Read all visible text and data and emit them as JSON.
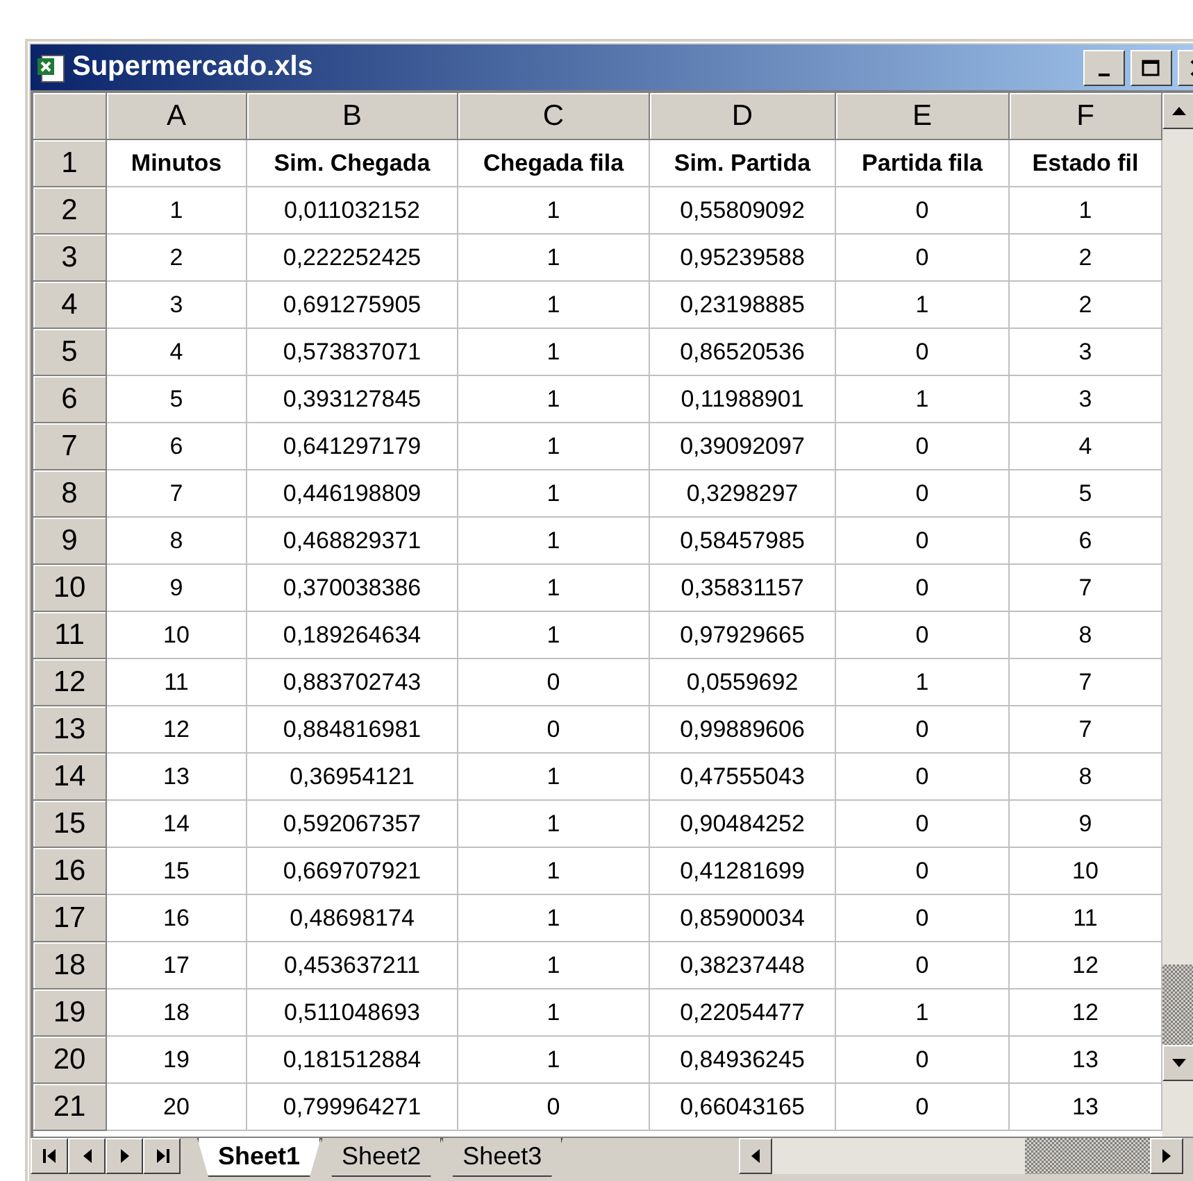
{
  "window": {
    "title": "Supermercado.xls"
  },
  "columns": [
    "A",
    "B",
    "C",
    "D",
    "E",
    "F"
  ],
  "label_row": {
    "number": "1",
    "cells": [
      "Minutos",
      "Sim. Chegada",
      "Chegada fila",
      "Sim. Partida",
      "Partida fila",
      "Estado fil"
    ]
  },
  "rows": [
    {
      "number": "2",
      "cells": [
        "1",
        "0,011032152",
        "1",
        "0,55809092",
        "0",
        "1"
      ]
    },
    {
      "number": "3",
      "cells": [
        "2",
        "0,222252425",
        "1",
        "0,95239588",
        "0",
        "2"
      ]
    },
    {
      "number": "4",
      "cells": [
        "3",
        "0,691275905",
        "1",
        "0,23198885",
        "1",
        "2"
      ]
    },
    {
      "number": "5",
      "cells": [
        "4",
        "0,573837071",
        "1",
        "0,86520536",
        "0",
        "3"
      ]
    },
    {
      "number": "6",
      "cells": [
        "5",
        "0,393127845",
        "1",
        "0,11988901",
        "1",
        "3"
      ]
    },
    {
      "number": "7",
      "cells": [
        "6",
        "0,641297179",
        "1",
        "0,39092097",
        "0",
        "4"
      ]
    },
    {
      "number": "8",
      "cells": [
        "7",
        "0,446198809",
        "1",
        "0,3298297",
        "0",
        "5"
      ]
    },
    {
      "number": "9",
      "cells": [
        "8",
        "0,468829371",
        "1",
        "0,58457985",
        "0",
        "6"
      ]
    },
    {
      "number": "10",
      "cells": [
        "9",
        "0,370038386",
        "1",
        "0,35831157",
        "0",
        "7"
      ]
    },
    {
      "number": "11",
      "cells": [
        "10",
        "0,189264634",
        "1",
        "0,97929665",
        "0",
        "8"
      ]
    },
    {
      "number": "12",
      "cells": [
        "11",
        "0,883702743",
        "0",
        "0,0559692",
        "1",
        "7"
      ]
    },
    {
      "number": "13",
      "cells": [
        "12",
        "0,884816981",
        "0",
        "0,99889606",
        "0",
        "7"
      ]
    },
    {
      "number": "14",
      "cells": [
        "13",
        "0,36954121",
        "1",
        "0,47555043",
        "0",
        "8"
      ]
    },
    {
      "number": "15",
      "cells": [
        "14",
        "0,592067357",
        "1",
        "0,90484252",
        "0",
        "9"
      ]
    },
    {
      "number": "16",
      "cells": [
        "15",
        "0,669707921",
        "1",
        "0,41281699",
        "0",
        "10"
      ]
    },
    {
      "number": "17",
      "cells": [
        "16",
        "0,48698174",
        "1",
        "0,85900034",
        "0",
        "11"
      ]
    },
    {
      "number": "18",
      "cells": [
        "17",
        "0,453637211",
        "1",
        "0,38237448",
        "0",
        "12"
      ]
    },
    {
      "number": "19",
      "cells": [
        "18",
        "0,511048693",
        "1",
        "0,22054477",
        "1",
        "12"
      ]
    },
    {
      "number": "20",
      "cells": [
        "19",
        "0,181512884",
        "1",
        "0,84936245",
        "0",
        "13"
      ]
    },
    {
      "number": "21",
      "cells": [
        "20",
        "0,799964271",
        "0",
        "0,66043165",
        "0",
        "13"
      ]
    }
  ],
  "sheet_tabs": [
    {
      "label": "Sheet1",
      "selected": true
    },
    {
      "label": "Sheet2",
      "selected": false
    },
    {
      "label": "Sheet3",
      "selected": false
    }
  ]
}
